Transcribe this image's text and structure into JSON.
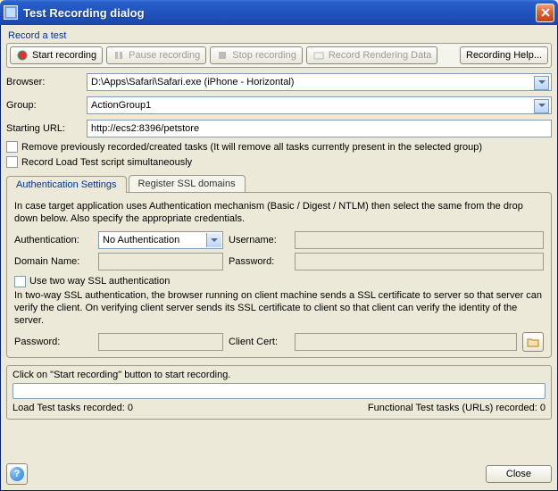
{
  "titlebar": {
    "title": "Test Recording dialog"
  },
  "groupbox_title": "Record a test",
  "toolbar": {
    "start": "Start recording",
    "pause": "Pause recording",
    "stop": "Stop recording",
    "record_render": "Record Rendering Data",
    "help": "Recording Help..."
  },
  "form": {
    "browser_label": "Browser:",
    "browser_value": "D:\\Apps\\Safari\\Safari.exe (iPhone - Horizontal)",
    "group_label": "Group:",
    "group_value": "ActionGroup1",
    "url_label": "Starting URL:",
    "url_value": "http://ecs2:8396/petstore",
    "remove_tasks": "Remove previously recorded/created tasks (It will remove all tasks currently present in the selected group)",
    "record_loadtest": "Record Load Test script simultaneously"
  },
  "tabs": {
    "auth": "Authentication Settings",
    "ssl": "Register SSL domains"
  },
  "auth_panel": {
    "description": "In case target application uses Authentication mechanism (Basic / Digest / NTLM) then select the same from the drop down below. Also specify the appropriate credentials.",
    "auth_label": "Authentication:",
    "auth_value": "No Authentication",
    "username_label": "Username:",
    "domain_label": "Domain Name:",
    "password_label": "Password:",
    "twoway_check": "Use two way SSL authentication",
    "twoway_desc": "In two-way SSL authentication, the browser running on client machine sends a SSL certificate to server so that server can verify the client. On verifying client server sends its SSL certificate to client so that client can verify the identity of the server.",
    "pw2_label": "Password:",
    "cert_label": "Client Cert:"
  },
  "status": {
    "hint": "Click on \"Start recording\" button to start recording.",
    "load_tasks": "Load Test tasks recorded: 0",
    "func_tasks": "Functional Test tasks (URLs) recorded: 0"
  },
  "buttons": {
    "close": "Close"
  }
}
